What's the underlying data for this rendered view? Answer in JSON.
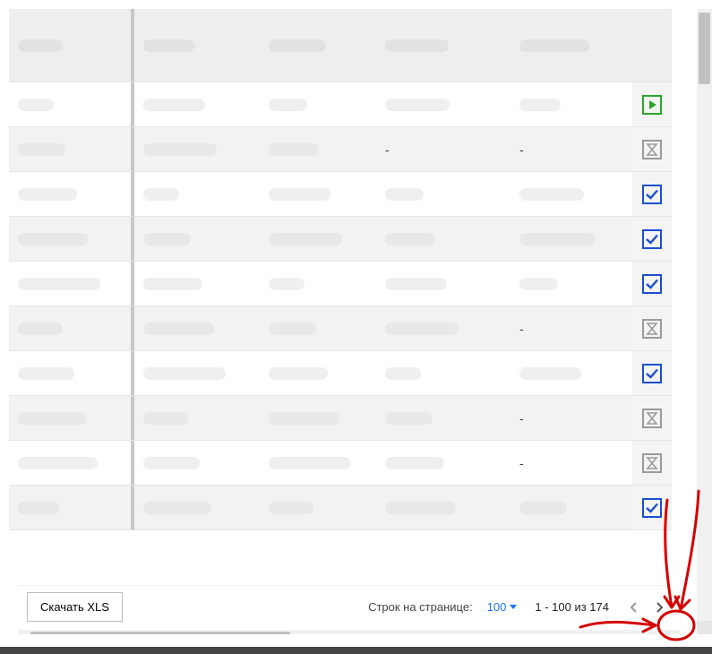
{
  "table": {
    "headers": [
      "",
      "",
      "",
      "",
      ""
    ],
    "rows": [
      {
        "cells": [
          "",
          "",
          "",
          "",
          ""
        ],
        "dash": [
          false,
          false,
          false,
          false,
          false
        ],
        "status": "play"
      },
      {
        "cells": [
          "",
          "",
          "",
          "-",
          "-"
        ],
        "dash": [
          false,
          false,
          false,
          true,
          true
        ],
        "status": "wait"
      },
      {
        "cells": [
          "",
          "",
          "",
          "",
          ""
        ],
        "dash": [
          false,
          false,
          false,
          false,
          false
        ],
        "status": "check"
      },
      {
        "cells": [
          "",
          "",
          "",
          "",
          ""
        ],
        "dash": [
          false,
          false,
          false,
          false,
          false
        ],
        "status": "check"
      },
      {
        "cells": [
          "",
          "",
          "",
          "",
          ""
        ],
        "dash": [
          false,
          false,
          false,
          false,
          false
        ],
        "status": "check"
      },
      {
        "cells": [
          "",
          "",
          "",
          "",
          "-"
        ],
        "dash": [
          false,
          false,
          false,
          false,
          true
        ],
        "status": "wait"
      },
      {
        "cells": [
          "",
          "",
          "",
          "",
          ""
        ],
        "dash": [
          false,
          false,
          false,
          false,
          false
        ],
        "status": "check"
      },
      {
        "cells": [
          "",
          "",
          "",
          "",
          "-"
        ],
        "dash": [
          false,
          false,
          false,
          false,
          true
        ],
        "status": "wait"
      },
      {
        "cells": [
          "",
          "",
          "",
          "",
          "-"
        ],
        "dash": [
          false,
          false,
          false,
          false,
          true
        ],
        "status": "wait"
      },
      {
        "cells": [
          "",
          "",
          "",
          "",
          ""
        ],
        "dash": [
          false,
          false,
          false,
          false,
          false
        ],
        "status": "check"
      }
    ]
  },
  "footer": {
    "download_label": "Скачать XLS",
    "rows_per_page_label": "Строк на странице:",
    "page_size": "100",
    "range_text": "1 - 100 из 174"
  },
  "icons": {
    "play": "play-icon",
    "wait": "hourglass-icon",
    "check": "check-icon",
    "chevron_left": "chevron-left-icon",
    "chevron_right": "chevron-right-icon",
    "dropdown": "dropdown-triangle-icon"
  },
  "colors": {
    "play_border": "#2aa52a",
    "play_fill": "#2aa52a",
    "wait": "#9a9a9a",
    "check": "#1a4fcf",
    "link": "#1a73e8"
  }
}
